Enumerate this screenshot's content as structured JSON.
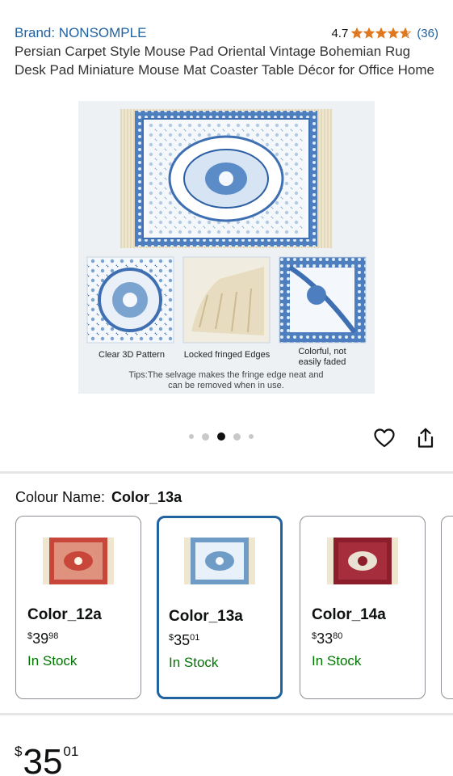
{
  "header": {
    "brand": "Brand: NONSOMPLE",
    "rating_value": "4.7",
    "rating_stars": 4.7,
    "rating_count": "(36)"
  },
  "product": {
    "title": "Persian Carpet Style Mouse Pad Oriental Vintage Bohemian Rug Desk Pad Miniature Mouse Mat Coaster Table Décor for Office Home"
  },
  "image": {
    "captions": [
      "Clear 3D Pattern",
      "Locked fringed Edges",
      "Colorful, not",
      "easily faded"
    ],
    "tip_line1": "Tips:The selvage makes the fringe edge neat and",
    "tip_line2": "can be removed when in use."
  },
  "carousel": {
    "total": 5,
    "active_index": 2
  },
  "actions": {
    "wishlist_icon": "heart-icon",
    "share_icon": "share-icon"
  },
  "colour": {
    "label": "Colour Name:",
    "selected": "Color_13a",
    "options": [
      {
        "name": "Color_12a",
        "price_dollars": "39",
        "price_cents": "98",
        "stock": "In Stock",
        "color": "#c8463a"
      },
      {
        "name": "Color_13a",
        "price_dollars": "35",
        "price_cents": "01",
        "stock": "In Stock",
        "color": "#6f9bc7"
      },
      {
        "name": "Color_14a",
        "price_dollars": "33",
        "price_cents": "80",
        "stock": "In Stock",
        "color": "#8c1d2a"
      }
    ]
  },
  "price": {
    "symbol": "$",
    "dollars": "35",
    "cents": "01"
  },
  "colors": {
    "link": "#2162a1",
    "star": "#de7921",
    "stock": "#007600",
    "selected_border": "#2162a1"
  }
}
